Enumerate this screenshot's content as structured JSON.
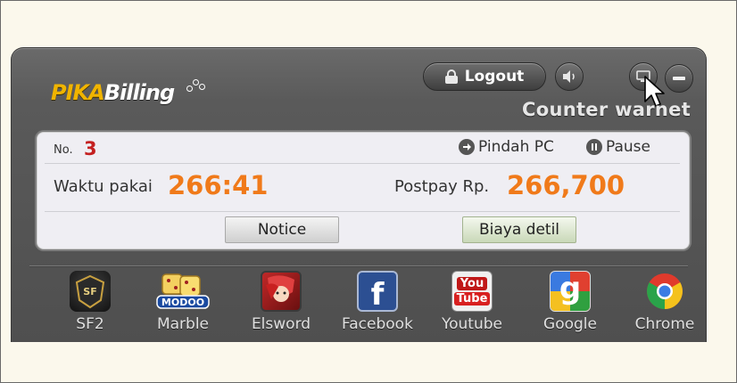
{
  "header": {
    "logo_part1": "PIKA",
    "logo_part2": "Billing",
    "logout_label": "Logout",
    "title": "Counter warnet"
  },
  "session": {
    "no_label": "No.",
    "no_value": "3",
    "pindah_label": "Pindah PC",
    "pause_label": "Pause",
    "waktu_label": "Waktu pakai",
    "waktu_value": "266:41",
    "postpay_label": "Postpay Rp.",
    "postpay_value": "266,700",
    "notice_label": "Notice",
    "biaya_label": "Biaya detil"
  },
  "apps": [
    {
      "label": "SF2",
      "icon": "sf2-icon"
    },
    {
      "label": "Marble",
      "icon": "modoo-marble-icon",
      "icon_text": "MODOO"
    },
    {
      "label": "Elsword",
      "icon": "elsword-icon"
    },
    {
      "label": "Facebook",
      "icon": "facebook-icon",
      "icon_text": "f"
    },
    {
      "label": "Youtube",
      "icon": "youtube-icon",
      "icon_text_1": "You",
      "icon_text_2": "Tube"
    },
    {
      "label": "Google",
      "icon": "google-icon",
      "icon_text": "g"
    },
    {
      "label": "Chrome",
      "icon": "chrome-icon"
    }
  ],
  "icon_sf2_text": "SF",
  "colors": {
    "accent_orange": "#f07a1a",
    "number_red": "#c42020",
    "logo_yellow": "#f0b400",
    "window_bg": "#4f4f4f",
    "panel_bg": "#efeef3"
  }
}
